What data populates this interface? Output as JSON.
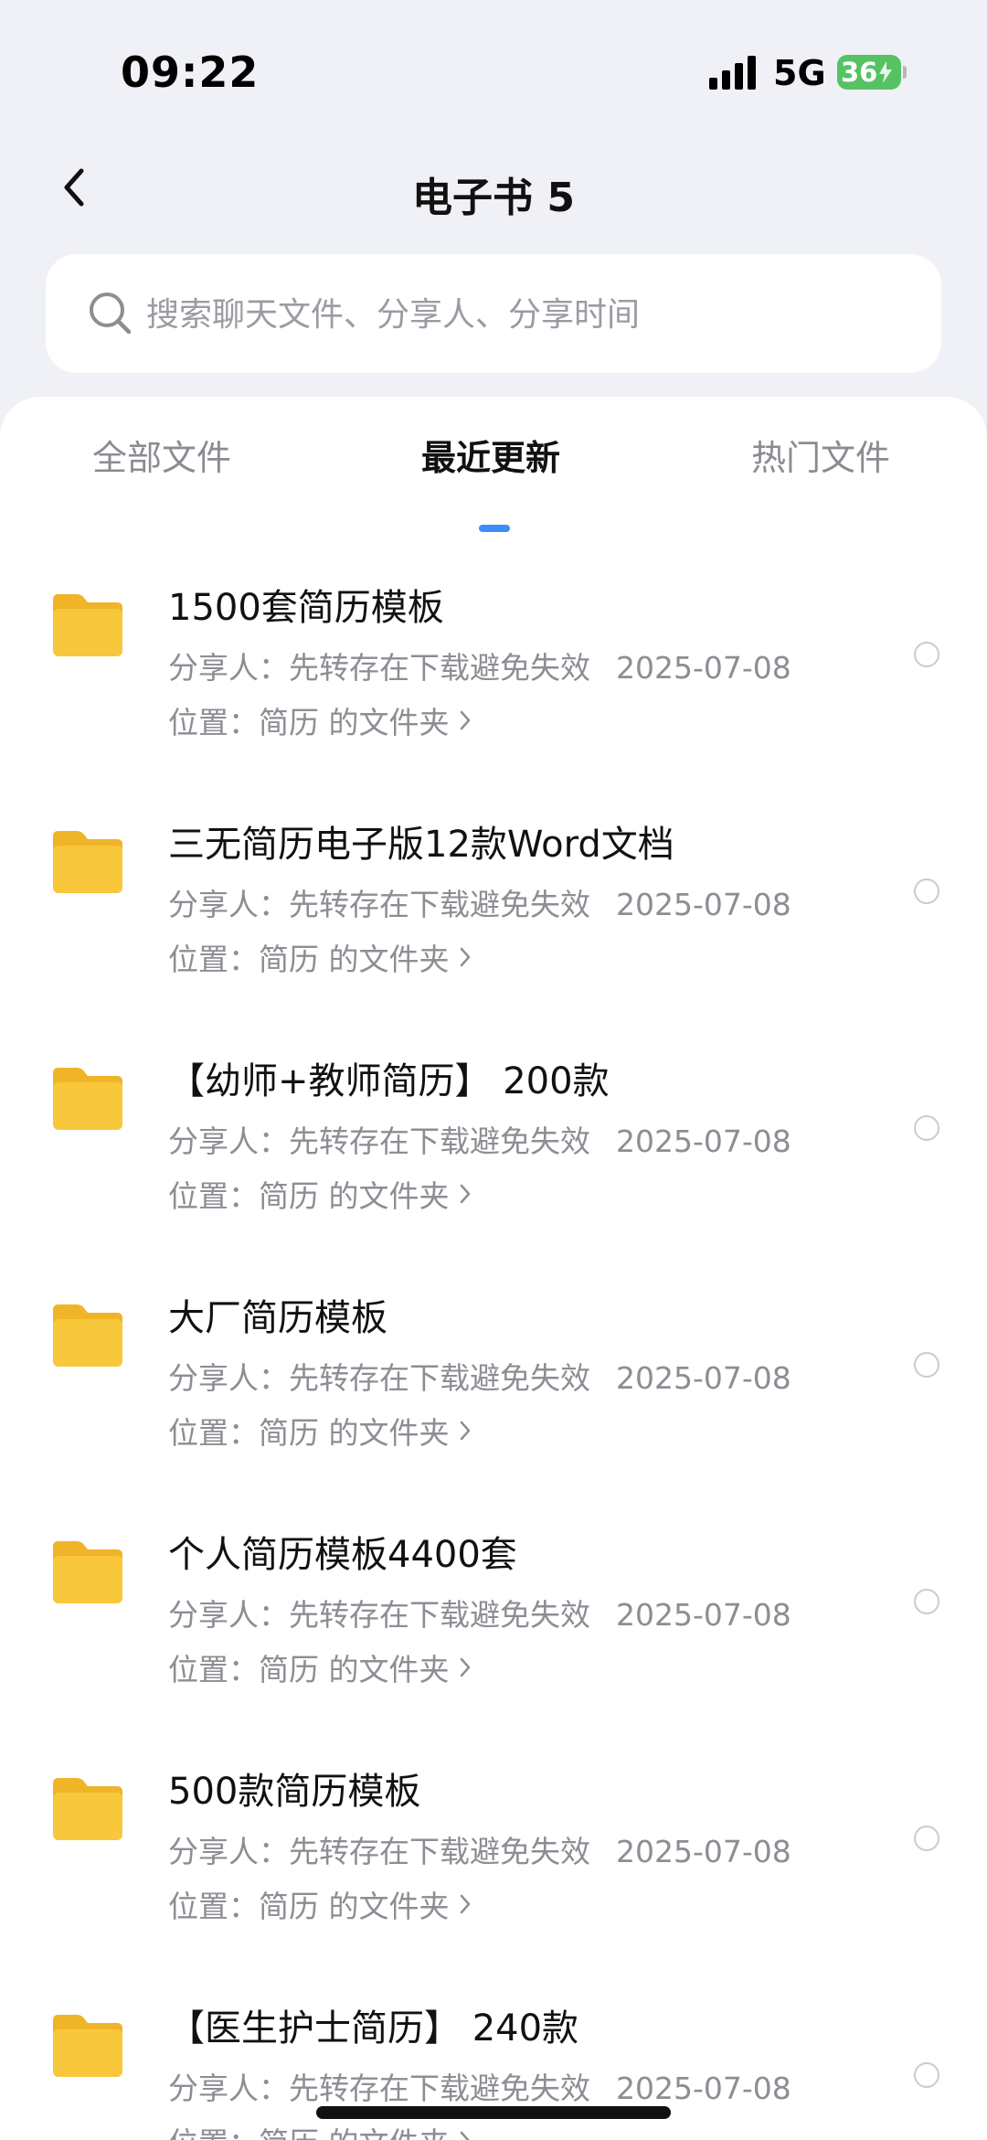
{
  "status_bar": {
    "time": "09:22",
    "network": "5G",
    "battery": "36"
  },
  "header": {
    "back_icon": "chevron-left-icon",
    "title": "电子书 5"
  },
  "search": {
    "placeholder": "搜索聊天文件、分享人、分享时间",
    "icon": "search-icon"
  },
  "tabs": [
    {
      "label": "全部文件",
      "active": false
    },
    {
      "label": "最近更新",
      "active": true
    },
    {
      "label": "热门文件",
      "active": false
    }
  ],
  "colors": {
    "accent": "#3c8cf7",
    "folder": "#f9c73b",
    "background": "#eff1f6"
  },
  "files": [
    {
      "name": "1500套简历模板",
      "sharer": "分享人：先转存在下载避免失效",
      "date": "2025-07-08",
      "location": "位置：简历 的文件夹"
    },
    {
      "name": "三无简历电子版12款Word文档",
      "sharer": "分享人：先转存在下载避免失效",
      "date": "2025-07-08",
      "location": "位置：简历 的文件夹"
    },
    {
      "name": "【幼师+教师简历】 200款",
      "sharer": "分享人：先转存在下载避免失效",
      "date": "2025-07-08",
      "location": "位置：简历 的文件夹"
    },
    {
      "name": "大厂简历模板",
      "sharer": "分享人：先转存在下载避免失效",
      "date": "2025-07-08",
      "location": "位置：简历 的文件夹"
    },
    {
      "name": "个人简历模板4400套",
      "sharer": "分享人：先转存在下载避免失效",
      "date": "2025-07-08",
      "location": "位置：简历 的文件夹"
    },
    {
      "name": "500款简历模板",
      "sharer": "分享人：先转存在下载避免失效",
      "date": "2025-07-08",
      "location": "位置：简历 的文件夹"
    },
    {
      "name": "【医生护士简历】 240款",
      "sharer": "分享人：先转存在下载避免失效",
      "date": "2025-07-08",
      "location": "位置：简历 的文件夹"
    }
  ]
}
